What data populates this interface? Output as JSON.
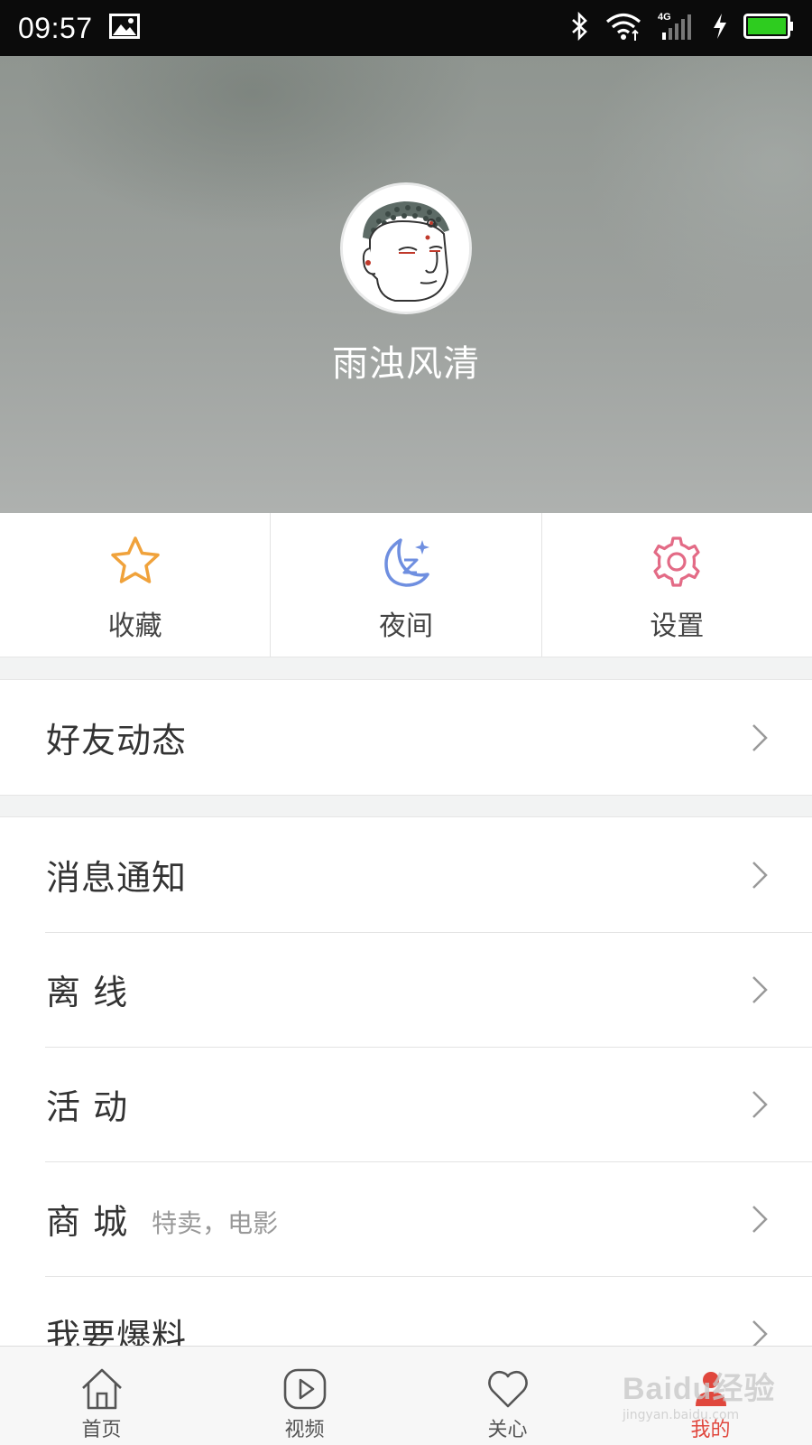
{
  "status_bar": {
    "time": "09:57",
    "network": "4G",
    "icons": [
      "image-icon",
      "bluetooth-icon",
      "wifi-icon",
      "signal-icon",
      "charging-icon",
      "battery-icon"
    ],
    "battery_color": "#2ecc1f"
  },
  "profile": {
    "username": "雨浊风清",
    "avatar": "buddha-avatar"
  },
  "quick_actions": [
    {
      "label": "收藏",
      "icon": "star-icon",
      "color": "#f0a23b"
    },
    {
      "label": "夜间",
      "icon": "moon-icon",
      "color": "#6f8fe0"
    },
    {
      "label": "设置",
      "icon": "gear-icon",
      "color": "#e36b86"
    }
  ],
  "menu": {
    "group1": [
      {
        "label": "好友动态"
      }
    ],
    "group2": [
      {
        "label": "消息通知"
      },
      {
        "label": "离 线"
      },
      {
        "label": "活 动"
      },
      {
        "label": "商 城",
        "sub": "特卖，电影"
      },
      {
        "label": "我要爆料"
      }
    ]
  },
  "tabbar": {
    "tabs": [
      {
        "label": "首页",
        "icon": "home-icon"
      },
      {
        "label": "视频",
        "icon": "video-play-icon"
      },
      {
        "label": "关心",
        "icon": "heart-icon"
      },
      {
        "label": "我的",
        "icon": "user-icon",
        "active": true
      }
    ],
    "active_color": "#e0473d"
  },
  "watermark": {
    "logo": "Baidu经验",
    "url": "jingyan.baidu.com"
  }
}
